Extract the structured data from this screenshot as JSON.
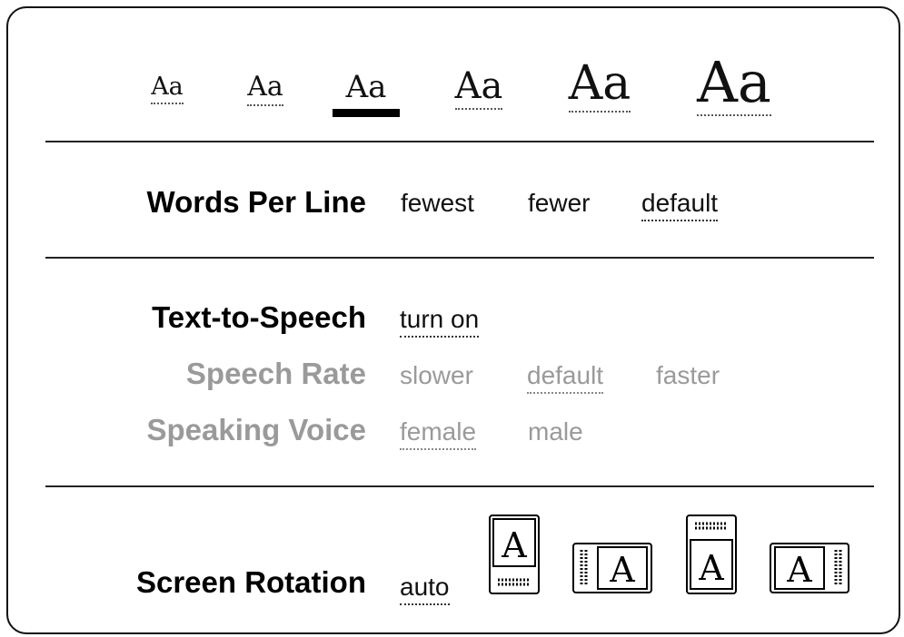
{
  "font_size": {
    "sample_text": "Aa",
    "selected_index": 2
  },
  "words_per_line": {
    "label": "Words Per Line",
    "options": [
      "fewest",
      "fewer",
      "default"
    ],
    "selected": "default"
  },
  "text_to_speech": {
    "label": "Text-to-Speech",
    "toggle": "turn on",
    "speech_rate": {
      "label": "Speech Rate",
      "options": [
        "slower",
        "default",
        "faster"
      ],
      "selected": "default"
    },
    "speaking_voice": {
      "label": "Speaking Voice",
      "options": [
        "female",
        "male"
      ],
      "selected": "female"
    }
  },
  "screen_rotation": {
    "label": "Screen Rotation",
    "auto": "auto",
    "icon_letter": "A",
    "icons": [
      "portrait-icon",
      "landscape-left-icon",
      "portrait-inverted-icon",
      "landscape-right-icon"
    ]
  },
  "colors": {
    "text": "#000000",
    "disabled_text": "#9a9a9a",
    "border": "#111111"
  }
}
